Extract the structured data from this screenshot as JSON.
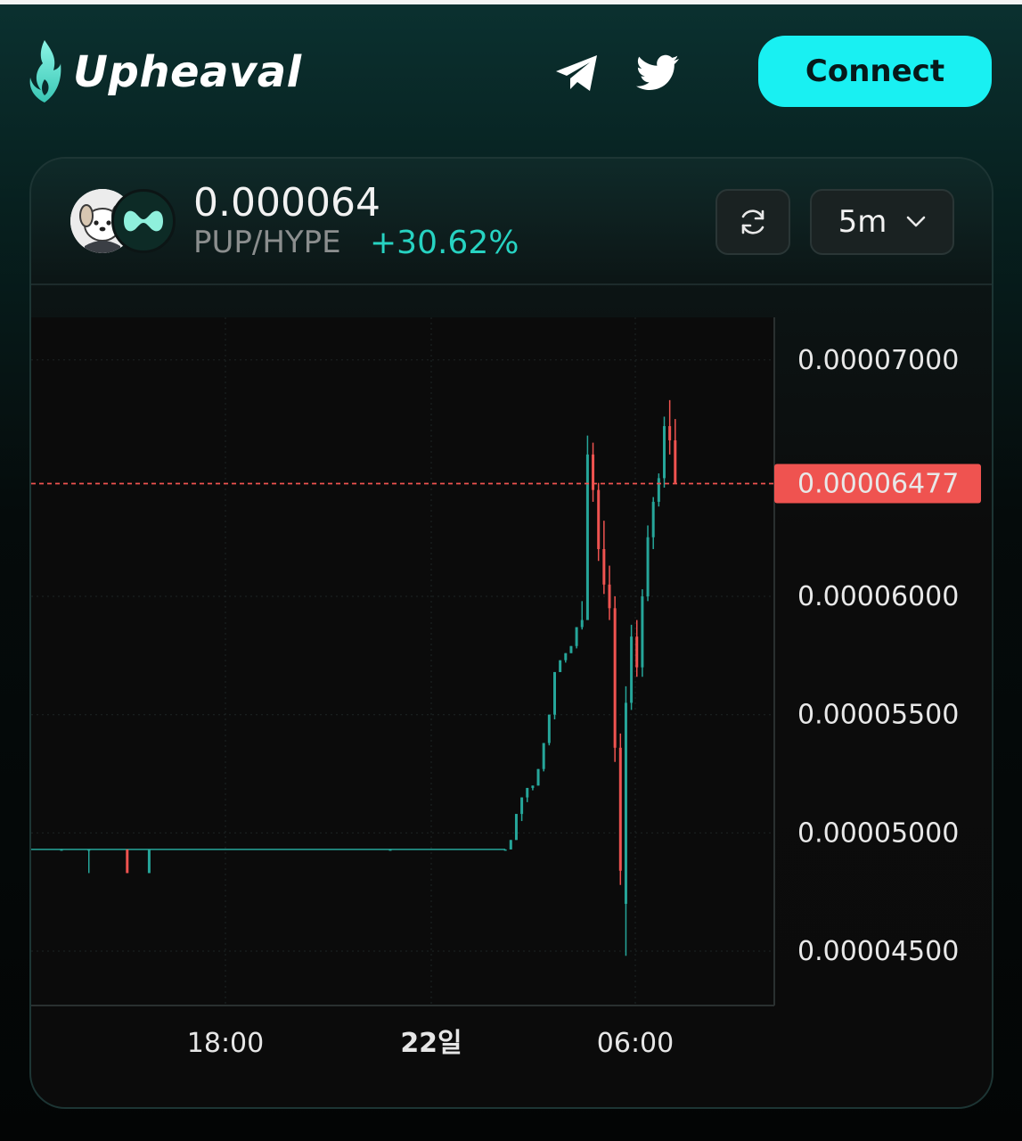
{
  "header": {
    "app_name": "Upheaval",
    "connect_label": "Connect",
    "icons": [
      "flame-logo-icon",
      "telegram-icon",
      "twitter-icon"
    ]
  },
  "pair": {
    "price": "0.000064",
    "name": "PUP/HYPE",
    "change": "+30.62%",
    "interval": "5m",
    "icons": [
      "pup-token-icon",
      "hype-token-icon",
      "refresh-icon",
      "chevron-down-icon"
    ]
  },
  "colors": {
    "accent": "#19f0f2",
    "up": "#26a69a",
    "down": "#ef5350",
    "change_text": "#27d3c2",
    "current_price_tag": "#ef5350"
  },
  "chart_data": {
    "type": "candlestick",
    "y_axis": {
      "tick_labels": [
        "0.00007000",
        "0.00006000",
        "0.00005500",
        "0.00005000",
        "0.00004500"
      ],
      "range": [
        4.27e-05,
        7.18e-05
      ]
    },
    "x_axis": {
      "tick_labels": [
        "18:00",
        "22일",
        "06:00"
      ],
      "bold_label": "22일"
    },
    "current_price": "0.00006477",
    "candles": [
      {
        "t": 0,
        "o": 4.93e-05,
        "h": 4.93e-05,
        "l": 4.93e-05,
        "c": 4.93e-05
      },
      {
        "t": 5,
        "o": 4.93e-05,
        "h": 4.93e-05,
        "l": 4.83e-05,
        "c": 4.93e-05
      },
      {
        "t": 12,
        "o": 4.93e-05,
        "h": 4.93e-05,
        "l": 4.83e-05,
        "c": 4.83e-05
      },
      {
        "t": 16,
        "o": 4.83e-05,
        "h": 4.93e-05,
        "l": 4.83e-05,
        "c": 4.93e-05
      },
      {
        "t": 60,
        "o": 4.93e-05,
        "h": 4.93e-05,
        "l": 4.93e-05,
        "c": 4.93e-05
      },
      {
        "t": 81,
        "o": 4.93e-05,
        "h": 4.93e-05,
        "l": 4.93e-05,
        "c": 4.93e-05
      },
      {
        "t": 82,
        "o": 4.93e-05,
        "h": 4.97e-05,
        "l": 4.93e-05,
        "c": 4.97e-05
      },
      {
        "t": 83,
        "o": 4.97e-05,
        "h": 5.08e-05,
        "l": 4.97e-05,
        "c": 5.08e-05
      },
      {
        "t": 84,
        "o": 5.08e-05,
        "h": 5.15e-05,
        "l": 5.05e-05,
        "c": 5.15e-05
      },
      {
        "t": 85,
        "o": 5.15e-05,
        "h": 5.19e-05,
        "l": 5.13e-05,
        "c": 5.19e-05
      },
      {
        "t": 86,
        "o": 5.19e-05,
        "h": 5.2e-05,
        "l": 5.18e-05,
        "c": 5.2e-05
      },
      {
        "t": 87,
        "o": 5.2e-05,
        "h": 5.27e-05,
        "l": 5.2e-05,
        "c": 5.27e-05
      },
      {
        "t": 88,
        "o": 5.27e-05,
        "h": 5.38e-05,
        "l": 5.26e-05,
        "c": 5.38e-05
      },
      {
        "t": 89,
        "o": 5.38e-05,
        "h": 5.5e-05,
        "l": 5.37e-05,
        "c": 5.5e-05
      },
      {
        "t": 90,
        "o": 5.5e-05,
        "h": 5.68e-05,
        "l": 5.48e-05,
        "c": 5.68e-05
      },
      {
        "t": 91,
        "o": 5.68e-05,
        "h": 5.73e-05,
        "l": 5.68e-05,
        "c": 5.73e-05
      },
      {
        "t": 92,
        "o": 5.73e-05,
        "h": 5.76e-05,
        "l": 5.72e-05,
        "c": 5.76e-05
      },
      {
        "t": 93,
        "o": 5.76e-05,
        "h": 5.79e-05,
        "l": 5.76e-05,
        "c": 5.79e-05
      },
      {
        "t": 94,
        "o": 5.79e-05,
        "h": 5.87e-05,
        "l": 5.78e-05,
        "c": 5.87e-05
      },
      {
        "t": 95,
        "o": 5.87e-05,
        "h": 5.98e-05,
        "l": 5.86e-05,
        "c": 5.9e-05
      },
      {
        "t": 96,
        "o": 5.9e-05,
        "h": 6.68e-05,
        "l": 6.15e-05,
        "c": 6.6e-05
      },
      {
        "t": 97,
        "o": 6.6e-05,
        "h": 6.65e-05,
        "l": 6.4e-05,
        "c": 6.45e-05
      },
      {
        "t": 98,
        "o": 6.45e-05,
        "h": 6.48e-05,
        "l": 6.15e-05,
        "c": 6.2e-05
      },
      {
        "t": 99,
        "o": 6.2e-05,
        "h": 6.32e-05,
        "l": 6.01e-05,
        "c": 6.05e-05
      },
      {
        "t": 100,
        "o": 6.05e-05,
        "h": 6.13e-05,
        "l": 5.9e-05,
        "c": 5.95e-05
      },
      {
        "t": 101,
        "o": 5.95e-05,
        "h": 6e-05,
        "l": 5.3e-05,
        "c": 5.36e-05
      },
      {
        "t": 102,
        "o": 5.36e-05,
        "h": 5.42e-05,
        "l": 4.78e-05,
        "c": 4.84e-05
      },
      {
        "t": 103,
        "o": 4.7e-05,
        "h": 5.62e-05,
        "l": 4.48e-05,
        "c": 5.55e-05
      },
      {
        "t": 104,
        "o": 5.55e-05,
        "h": 5.88e-05,
        "l": 5.52e-05,
        "c": 5.83e-05
      },
      {
        "t": 105,
        "o": 5.83e-05,
        "h": 5.9e-05,
        "l": 5.66e-05,
        "c": 5.7e-05
      },
      {
        "t": 106,
        "o": 5.7e-05,
        "h": 6.03e-05,
        "l": 5.66e-05,
        "c": 6e-05
      },
      {
        "t": 107,
        "o": 6e-05,
        "h": 6.3e-05,
        "l": 5.98e-05,
        "c": 6.25e-05
      },
      {
        "t": 108,
        "o": 6.25e-05,
        "h": 6.42e-05,
        "l": 6.2e-05,
        "c": 6.4e-05
      },
      {
        "t": 109,
        "o": 6.4e-05,
        "h": 6.52e-05,
        "l": 6.38e-05,
        "c": 6.5e-05
      },
      {
        "t": 110,
        "o": 6.5e-05,
        "h": 6.76e-05,
        "l": 6.46e-05,
        "c": 6.72e-05
      },
      {
        "t": 111,
        "o": 6.72e-05,
        "h": 6.83e-05,
        "l": 6.6e-05,
        "c": 6.66e-05
      },
      {
        "t": 112,
        "o": 6.66e-05,
        "h": 6.75e-05,
        "l": 6.48e-05,
        "c": 6.48e-05
      }
    ]
  }
}
